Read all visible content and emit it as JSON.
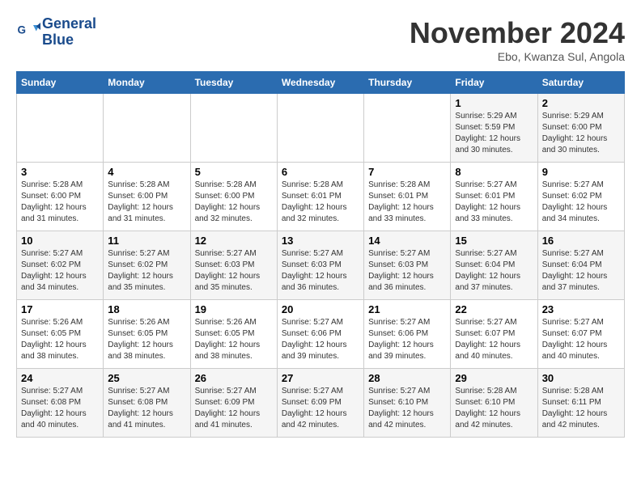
{
  "logo": {
    "line1": "General",
    "line2": "Blue"
  },
  "title": "November 2024",
  "subtitle": "Ebo, Kwanza Sul, Angola",
  "columns": [
    "Sunday",
    "Monday",
    "Tuesday",
    "Wednesday",
    "Thursday",
    "Friday",
    "Saturday"
  ],
  "weeks": [
    [
      {
        "day": "",
        "info": ""
      },
      {
        "day": "",
        "info": ""
      },
      {
        "day": "",
        "info": ""
      },
      {
        "day": "",
        "info": ""
      },
      {
        "day": "",
        "info": ""
      },
      {
        "day": "1",
        "info": "Sunrise: 5:29 AM\nSunset: 5:59 PM\nDaylight: 12 hours and 30 minutes."
      },
      {
        "day": "2",
        "info": "Sunrise: 5:29 AM\nSunset: 6:00 PM\nDaylight: 12 hours and 30 minutes."
      }
    ],
    [
      {
        "day": "3",
        "info": "Sunrise: 5:28 AM\nSunset: 6:00 PM\nDaylight: 12 hours and 31 minutes."
      },
      {
        "day": "4",
        "info": "Sunrise: 5:28 AM\nSunset: 6:00 PM\nDaylight: 12 hours and 31 minutes."
      },
      {
        "day": "5",
        "info": "Sunrise: 5:28 AM\nSunset: 6:00 PM\nDaylight: 12 hours and 32 minutes."
      },
      {
        "day": "6",
        "info": "Sunrise: 5:28 AM\nSunset: 6:01 PM\nDaylight: 12 hours and 32 minutes."
      },
      {
        "day": "7",
        "info": "Sunrise: 5:28 AM\nSunset: 6:01 PM\nDaylight: 12 hours and 33 minutes."
      },
      {
        "day": "8",
        "info": "Sunrise: 5:27 AM\nSunset: 6:01 PM\nDaylight: 12 hours and 33 minutes."
      },
      {
        "day": "9",
        "info": "Sunrise: 5:27 AM\nSunset: 6:02 PM\nDaylight: 12 hours and 34 minutes."
      }
    ],
    [
      {
        "day": "10",
        "info": "Sunrise: 5:27 AM\nSunset: 6:02 PM\nDaylight: 12 hours and 34 minutes."
      },
      {
        "day": "11",
        "info": "Sunrise: 5:27 AM\nSunset: 6:02 PM\nDaylight: 12 hours and 35 minutes."
      },
      {
        "day": "12",
        "info": "Sunrise: 5:27 AM\nSunset: 6:03 PM\nDaylight: 12 hours and 35 minutes."
      },
      {
        "day": "13",
        "info": "Sunrise: 5:27 AM\nSunset: 6:03 PM\nDaylight: 12 hours and 36 minutes."
      },
      {
        "day": "14",
        "info": "Sunrise: 5:27 AM\nSunset: 6:03 PM\nDaylight: 12 hours and 36 minutes."
      },
      {
        "day": "15",
        "info": "Sunrise: 5:27 AM\nSunset: 6:04 PM\nDaylight: 12 hours and 37 minutes."
      },
      {
        "day": "16",
        "info": "Sunrise: 5:27 AM\nSunset: 6:04 PM\nDaylight: 12 hours and 37 minutes."
      }
    ],
    [
      {
        "day": "17",
        "info": "Sunrise: 5:26 AM\nSunset: 6:05 PM\nDaylight: 12 hours and 38 minutes."
      },
      {
        "day": "18",
        "info": "Sunrise: 5:26 AM\nSunset: 6:05 PM\nDaylight: 12 hours and 38 minutes."
      },
      {
        "day": "19",
        "info": "Sunrise: 5:26 AM\nSunset: 6:05 PM\nDaylight: 12 hours and 38 minutes."
      },
      {
        "day": "20",
        "info": "Sunrise: 5:27 AM\nSunset: 6:06 PM\nDaylight: 12 hours and 39 minutes."
      },
      {
        "day": "21",
        "info": "Sunrise: 5:27 AM\nSunset: 6:06 PM\nDaylight: 12 hours and 39 minutes."
      },
      {
        "day": "22",
        "info": "Sunrise: 5:27 AM\nSunset: 6:07 PM\nDaylight: 12 hours and 40 minutes."
      },
      {
        "day": "23",
        "info": "Sunrise: 5:27 AM\nSunset: 6:07 PM\nDaylight: 12 hours and 40 minutes."
      }
    ],
    [
      {
        "day": "24",
        "info": "Sunrise: 5:27 AM\nSunset: 6:08 PM\nDaylight: 12 hours and 40 minutes."
      },
      {
        "day": "25",
        "info": "Sunrise: 5:27 AM\nSunset: 6:08 PM\nDaylight: 12 hours and 41 minutes."
      },
      {
        "day": "26",
        "info": "Sunrise: 5:27 AM\nSunset: 6:09 PM\nDaylight: 12 hours and 41 minutes."
      },
      {
        "day": "27",
        "info": "Sunrise: 5:27 AM\nSunset: 6:09 PM\nDaylight: 12 hours and 42 minutes."
      },
      {
        "day": "28",
        "info": "Sunrise: 5:27 AM\nSunset: 6:10 PM\nDaylight: 12 hours and 42 minutes."
      },
      {
        "day": "29",
        "info": "Sunrise: 5:28 AM\nSunset: 6:10 PM\nDaylight: 12 hours and 42 minutes."
      },
      {
        "day": "30",
        "info": "Sunrise: 5:28 AM\nSunset: 6:11 PM\nDaylight: 12 hours and 42 minutes."
      }
    ]
  ]
}
